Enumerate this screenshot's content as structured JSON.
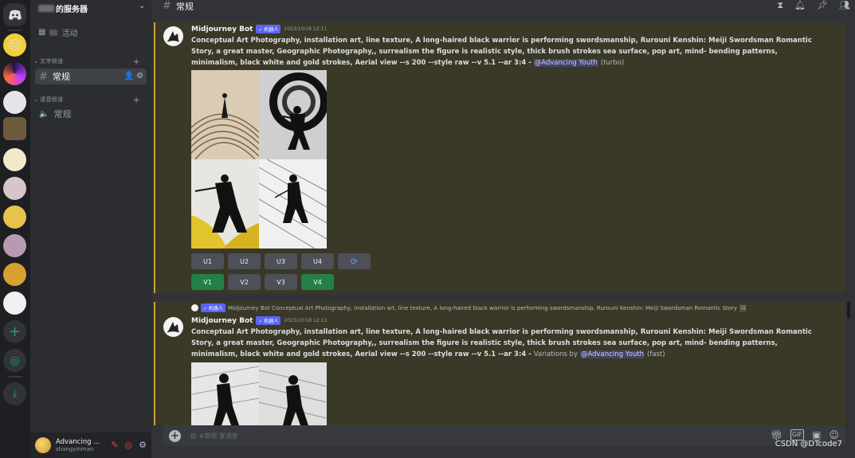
{
  "server": {
    "name_visible": "的服务器",
    "events_label": "活动",
    "categories": [
      {
        "label": "文字频道"
      },
      {
        "label": "语音频道"
      }
    ],
    "channels": [
      {
        "label": "常规",
        "type": "text",
        "active": true
      },
      {
        "label": "常规",
        "type": "voice",
        "active": false
      }
    ]
  },
  "user": {
    "name": "Advancing ...",
    "status": "shangyinman"
  },
  "topbar": {
    "channel": "常规"
  },
  "messages": [
    {
      "author": "Midjourney Bot",
      "bot_tag": "✓ 机器人",
      "timestamp": "2023/10/18 12:11",
      "prompt": "Conceptual Art Photography, installation art, line texture, A long-haired black warrior is performing swordsmanship, Rurouni Kenshin: Meiji Swordsman Romantic Story, a great master, Geographic Photography,, surrealism the figure is realistic style, thick brush strokes sea surface, pop art, mind- bending patterns, minimalism, black white and gold strokes, Aerial view --s 200 --style raw --v 5.1 --ar 3:4 -",
      "mention": "@Advancing Youth",
      "suffix": "(turbo)",
      "buttons_row1": [
        "U1",
        "U2",
        "U3",
        "U4",
        "⟳"
      ],
      "buttons_row2": [
        "V1",
        "V2",
        "V3",
        "V4"
      ]
    },
    {
      "reply_preview": "Midjourney Bot Conceptual Art Photography, installation art, line texture, A long-haired black warrior is performing swordsmanship, Rurouni Kenshin: Meiji Swordsman Romantic Story",
      "reply_tag": "✓ 机器人",
      "author": "Midjourney Bot",
      "bot_tag": "✓ 机器人",
      "timestamp": "2023/10/18 12:13",
      "prompt": "Conceptual Art Photography, installation art, line texture, A long-haired black warrior is performing swordsmanship, Rurouni Kenshin: Meiji Swordsman Romantic Story, a great master, Geographic Photography,, surrealism the figure is realistic style, thick brush strokes sea surface, pop art, mind- bending patterns, minimalism, black white and gold strokes, Aerial view --s 200 --style raw --v 5.1 --ar 3:4 -",
      "variations_label": "Variations by",
      "mention": "@Advancing Youth",
      "suffix": "(fast)"
    }
  ],
  "input": {
    "placeholder": "给 #常规 发消息"
  },
  "watermark": "CSDN @DTcode7",
  "colors": {
    "accent": "#5865f2",
    "highlight": "#c8a232",
    "green": "#248046"
  }
}
